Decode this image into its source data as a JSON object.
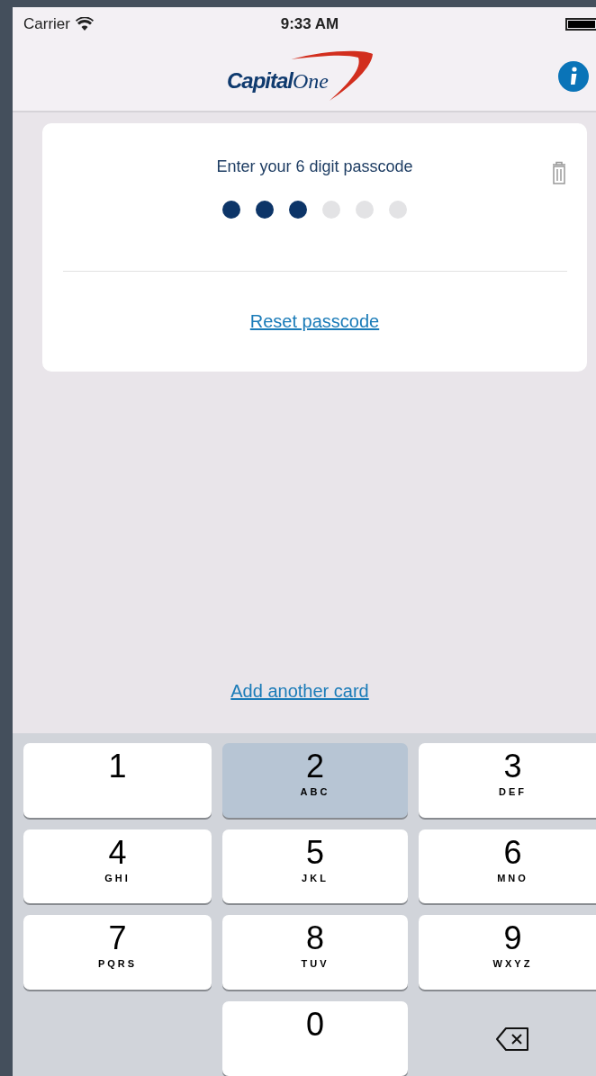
{
  "status_bar": {
    "carrier": "Carrier",
    "time": "9:33 AM"
  },
  "nav": {
    "logo": {
      "word1": "Capital",
      "word2": "One"
    }
  },
  "passcode_card": {
    "prompt": "Enter your 6 digit passcode",
    "dots": [
      {
        "filled": true
      },
      {
        "filled": true
      },
      {
        "filled": true
      },
      {
        "filled": false
      },
      {
        "filled": false
      },
      {
        "filled": false
      }
    ],
    "reset_link": "Reset passcode"
  },
  "add_card_link": "Add another card",
  "keypad": [
    {
      "kind": "digit",
      "digit": "1",
      "selected": false
    },
    {
      "kind": "digit",
      "digit": "2",
      "letters": "ABC",
      "selected": true
    },
    {
      "kind": "digit",
      "digit": "3",
      "letters": "DEF",
      "selected": false
    },
    {
      "kind": "digit",
      "digit": "4",
      "letters": "GHI",
      "selected": false
    },
    {
      "kind": "digit",
      "digit": "5",
      "letters": "JKL",
      "selected": false
    },
    {
      "kind": "digit",
      "digit": "6",
      "letters": "MNO",
      "selected": false
    },
    {
      "kind": "digit",
      "digit": "7",
      "letters": "PQRS",
      "selected": false
    },
    {
      "kind": "digit",
      "digit": "8",
      "letters": "TUV",
      "selected": false
    },
    {
      "kind": "digit",
      "digit": "9",
      "letters": "WXYZ",
      "selected": false
    },
    {
      "kind": "blank"
    },
    {
      "kind": "digit",
      "digit": "0",
      "selected": false
    },
    {
      "kind": "delete"
    }
  ]
}
